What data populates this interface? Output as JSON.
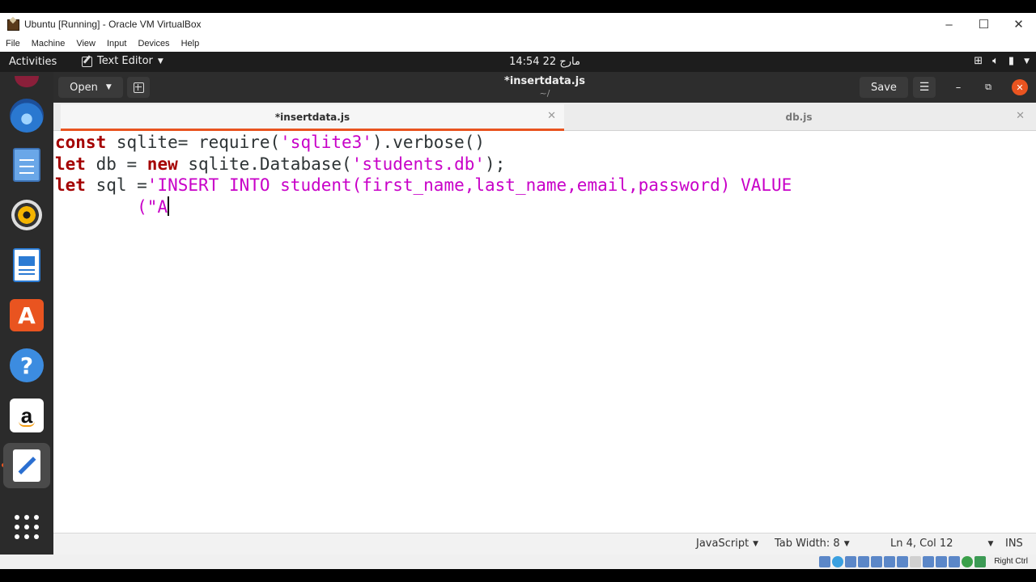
{
  "host_window": {
    "title": "Ubuntu [Running] - Oracle VM VirtualBox",
    "controls": {
      "minimize": "–",
      "maximize": "☐",
      "close": "✕"
    },
    "menu": [
      "File",
      "Machine",
      "View",
      "Input",
      "Devices",
      "Help"
    ],
    "status": {
      "host_key": "Right Ctrl"
    }
  },
  "topbar": {
    "activities": "Activities",
    "app_menu": "Text Editor",
    "clock": "14:54 22 مارج"
  },
  "dock": {
    "items": [
      "thunderbird-icon",
      "files-icon",
      "rhythmbox-icon",
      "libreoffice-writer-icon",
      "ubuntu-software-icon",
      "help-icon",
      "amazon-icon",
      "text-editor-icon",
      "show-applications-icon"
    ],
    "amazon_glyph": "a",
    "store_glyph": "A",
    "help_glyph": "?"
  },
  "headerbar": {
    "open_label": "Open",
    "title": "*insertdata.js",
    "subtitle": "~/",
    "save_label": "Save"
  },
  "tabs": [
    {
      "label": "*insertdata.js",
      "active": true
    },
    {
      "label": "db.js",
      "active": false
    }
  ],
  "code": {
    "lines": [
      [
        {
          "t": "kw",
          "v": "const"
        },
        {
          "t": "plain",
          "v": " sqlite= require("
        },
        {
          "t": "str",
          "v": "'sqlite3'"
        },
        {
          "t": "plain",
          "v": ").verbose()"
        }
      ],
      [
        {
          "t": "kw",
          "v": "let"
        },
        {
          "t": "plain",
          "v": " db = "
        },
        {
          "t": "kw",
          "v": "new"
        },
        {
          "t": "plain",
          "v": " sqlite.Database("
        },
        {
          "t": "str",
          "v": "'students.db'"
        },
        {
          "t": "plain",
          "v": ");"
        }
      ],
      [
        {
          "t": "kw",
          "v": "let"
        },
        {
          "t": "plain",
          "v": " sql ="
        },
        {
          "t": "str",
          "v": "'INSERT INTO student(first_name,last_name,email,password) VALUE"
        }
      ],
      [
        {
          "t": "plain",
          "v": "        "
        },
        {
          "t": "str",
          "v": "(\"A"
        }
      ]
    ]
  },
  "statusbar": {
    "language": "JavaScript",
    "tab_width": "Tab Width: 8",
    "position": "Ln 4, Col 12",
    "mode": "INS"
  },
  "colors": {
    "accent": "#e95420",
    "keyword": "#a40000",
    "string": "#c800c8",
    "headerbar": "#2d2d2d",
    "dock": "#2b2b2b"
  }
}
